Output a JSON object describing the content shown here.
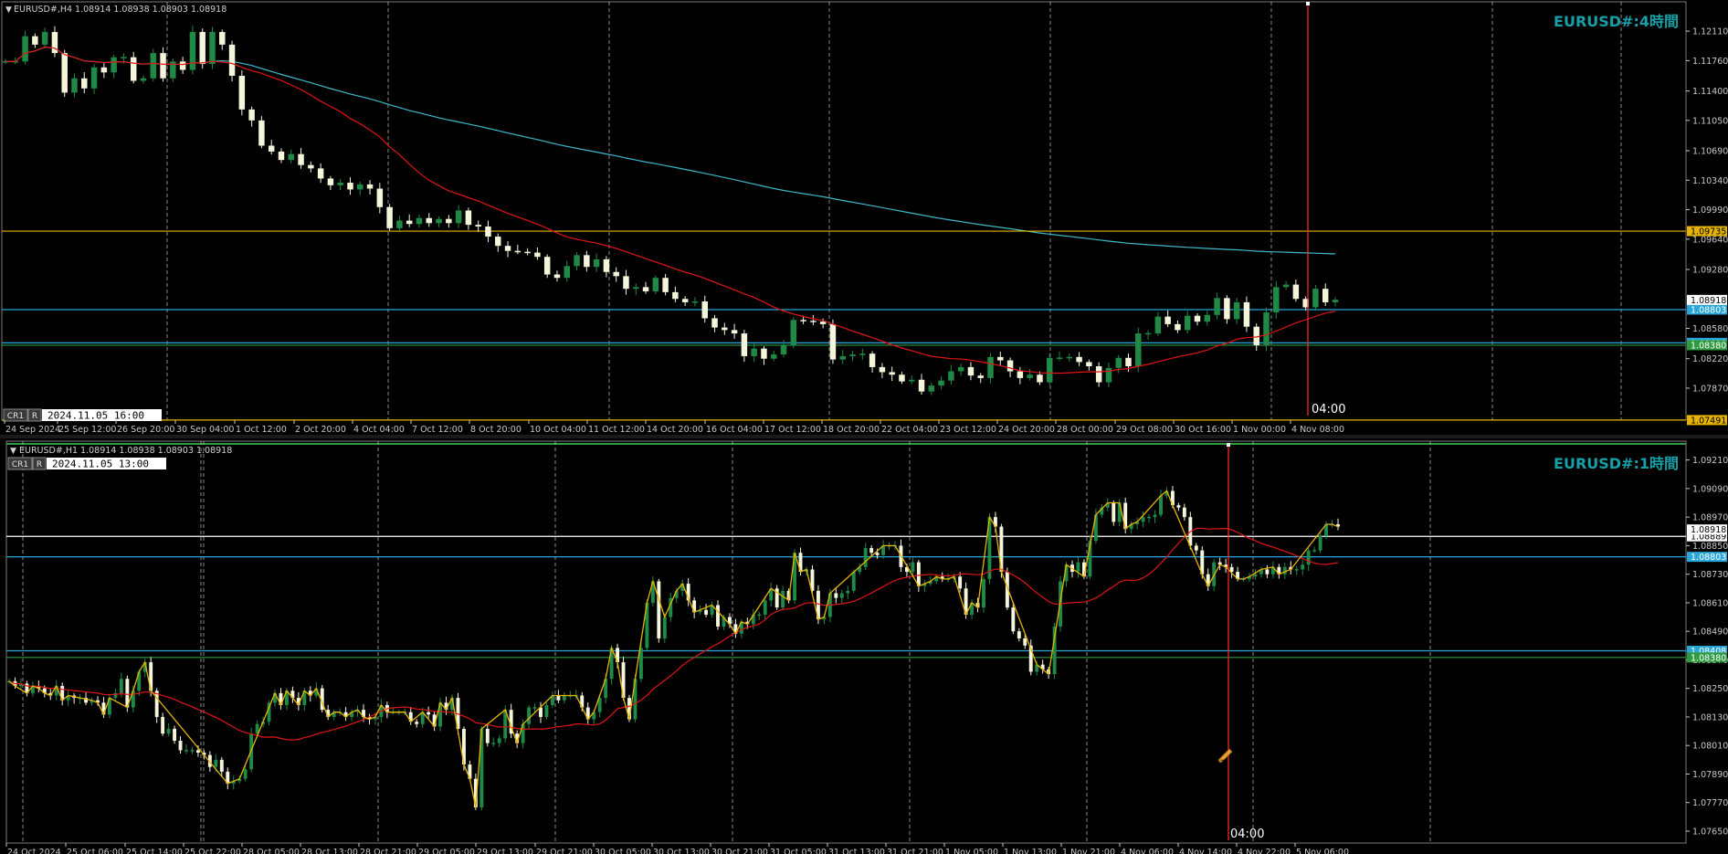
{
  "colors": {
    "background": "#000000",
    "grid": "#c8c8c8",
    "axis_text": "#c8c8c8",
    "candle_up": "#1f8a46",
    "candle_down": "#f5f5dc",
    "ma_red": "#e01515",
    "ma_cyan": "#3fb7c7",
    "zigzag": "#e6b400",
    "title": "#18a0a8",
    "crosshair": "#ff2a2a",
    "line_yellow": "#e6b400",
    "line_blue": "#2aa7d8",
    "line_green": "#2f9a40",
    "line_white": "#ffffff"
  },
  "top_panel": {
    "header": "EURUSD#,H4  1.08914 1.08938 1.08903 1.08918",
    "title": "EURUSD#:4時間",
    "controls": [
      "CR1",
      "R"
    ],
    "datetime_box": "2024.11.05 16:00",
    "crosshair_label": "04:00"
  },
  "bottom_panel": {
    "header": "EURUSD#,H1  1.08914 1.08938 1.08903 1.08918",
    "title": "EURUSD#:1時間",
    "controls": [
      "CR1",
      "R"
    ],
    "datetime_box": "2024.11.05 13:00",
    "crosshair_label": "04:00"
  },
  "chart_data": [
    {
      "type": "candlestick",
      "symbol": "EURUSD#",
      "timeframe": "H4",
      "title": "EURUSD#:4時間",
      "ylim": [
        1.0749,
        1.1235
      ],
      "y_ticks": [
        "1.12110",
        "1.11760",
        "1.11400",
        "1.11050",
        "1.10690",
        "1.10340",
        "1.09990",
        "1.09640",
        "1.09280",
        "1.08580",
        "1.08220",
        "1.07870"
      ],
      "x_ticks": [
        "24 Sep 2024",
        "25 Sep 12:00",
        "26 Sep 20:00",
        "30 Sep 04:00",
        "1 Oct 12:00",
        "2 Oct 20:00",
        "4 Oct 04:00",
        "7 Oct 12:00",
        "8 Oct 20:00",
        "10 Oct 04:00",
        "11 Oct 12:00",
        "14 Oct 20:00",
        "16 Oct 04:00",
        "17 Oct 12:00",
        "18 Oct 20:00",
        "22 Oct 04:00",
        "23 Oct 12:00",
        "24 Oct 20:00",
        "28 Oct 00:00",
        "29 Oct 08:00",
        "30 Oct 16:00",
        "1 Nov 00:00",
        "4 Nov 08:00"
      ],
      "horizontal_lines": [
        {
          "price": 1.09735,
          "label": "1.09735",
          "color": "#e6b400"
        },
        {
          "price": 1.08803,
          "label": "1.08803",
          "color": "#2aa7d8"
        },
        {
          "price": 1.08408,
          "label": "1.08408",
          "color": "#2aa7d8"
        },
        {
          "price": 1.0838,
          "label": "1.08380",
          "color": "#2f9a40"
        },
        {
          "price": 1.07491,
          "label": "1.07491",
          "color": "#e6b400"
        }
      ],
      "current_price": {
        "price": 1.08918,
        "label": "1.08918"
      },
      "closes": [
        1.1175,
        1.1175,
        1.1205,
        1.1195,
        1.121,
        1.1185,
        1.1138,
        1.1155,
        1.1143,
        1.1168,
        1.1162,
        1.118,
        1.118,
        1.1152,
        1.1155,
        1.1185,
        1.1155,
        1.1175,
        1.1165,
        1.121,
        1.1172,
        1.121,
        1.1195,
        1.1158,
        1.1118,
        1.1105,
        1.1075,
        1.1068,
        1.1058,
        1.1065,
        1.1052,
        1.1048,
        1.1036,
        1.1028,
        1.1031,
        1.1023,
        1.1029,
        1.1024,
        1.1002,
        1.0977,
        1.0986,
        1.0982,
        1.0989,
        1.0983,
        1.0988,
        1.0983,
        1.0998,
        1.0981,
        1.0979,
        1.0967,
        1.0956,
        1.095,
        1.0949,
        1.0948,
        1.0943,
        1.0922,
        1.0918,
        1.0932,
        1.0945,
        1.0931,
        1.094,
        1.0925,
        1.092,
        1.0905,
        1.0907,
        1.0902,
        1.0918,
        1.0901,
        1.0893,
        1.0889,
        1.089,
        1.087,
        1.0859,
        1.0856,
        1.0852,
        1.0825,
        1.0834,
        1.0822,
        1.0827,
        1.0838,
        1.0868,
        1.0867,
        1.0866,
        1.0863,
        1.0821,
        1.0825,
        1.0827,
        1.0828,
        1.0812,
        1.0806,
        1.0803,
        1.0795,
        1.0797,
        1.0783,
        1.079,
        1.0796,
        1.0807,
        1.0812,
        1.0802,
        1.0799,
        1.0824,
        1.082,
        1.0807,
        1.0799,
        1.0803,
        1.0794,
        1.0823,
        1.0823,
        1.0824,
        1.0818,
        1.0813,
        1.0794,
        1.0811,
        1.0823,
        1.0813,
        1.0852,
        1.0852,
        1.0872,
        1.0863,
        1.0856,
        1.0873,
        1.0866,
        1.0874,
        1.0894,
        1.0869,
        1.0889,
        1.086,
        1.0838,
        1.0877,
        1.0907,
        1.091,
        1.0893,
        1.0883,
        1.0905,
        1.0889,
        1.0892
      ]
    },
    {
      "type": "candlestick",
      "symbol": "EURUSD#",
      "timeframe": "H1",
      "title": "EURUSD#:1時間",
      "ylim": [
        1.076,
        1.0927
      ],
      "y_ticks": [
        "1.09210",
        "1.09090",
        "1.08970",
        "1.08850",
        "1.08730",
        "1.08610",
        "1.08490",
        "1.08370",
        "1.08250",
        "1.08130",
        "1.08010",
        "1.07890",
        "1.07770",
        "1.07650"
      ],
      "x_ticks": [
        "24 Oct 2024",
        "25 Oct 06:00",
        "25 Oct 14:00",
        "25 Oct 22:00",
        "28 Oct 05:00",
        "28 Oct 13:00",
        "28 Oct 21:00",
        "29 Oct 05:00",
        "29 Oct 13:00",
        "29 Oct 21:00",
        "30 Oct 05:00",
        "30 Oct 13:00",
        "30 Oct 21:00",
        "31 Oct 05:00",
        "31 Oct 13:00",
        "31 Oct 21:00",
        "1 Nov 05:00",
        "1 Nov 13:00",
        "1 Nov 21:00",
        "4 Nov 06:00",
        "4 Nov 14:00",
        "4 Nov 22:00",
        "5 Nov 06:00"
      ],
      "horizontal_lines": [
        {
          "price": 1.08889,
          "label": "1.08889",
          "color": "#ffffff"
        },
        {
          "price": 1.08803,
          "label": "1.08803",
          "color": "#2aa7d8"
        },
        {
          "price": 1.08408,
          "label": "1.08408",
          "color": "#2aa7d8"
        },
        {
          "price": 1.0838,
          "label": "1.08380",
          "color": "#2f9a40"
        }
      ],
      "current_price": {
        "price": 1.08918,
        "label": "1.08918"
      },
      "closes": [
        1.0828,
        1.0826,
        1.0827,
        1.0823,
        1.0826,
        1.0825,
        1.0823,
        1.0822,
        1.0826,
        1.082,
        1.0822,
        1.0821,
        1.0821,
        1.0819,
        1.082,
        1.0819,
        1.0814,
        1.0821,
        1.0823,
        1.0829,
        1.0817,
        1.0824,
        1.0832,
        1.0836,
        1.0824,
        1.0813,
        1.0806,
        1.0808,
        1.0803,
        1.0799,
        1.0799,
        1.0799,
        1.0798,
        1.0797,
        1.0792,
        1.0795,
        1.079,
        1.0785,
        1.0786,
        1.0787,
        1.0791,
        1.0806,
        1.081,
        1.0811,
        1.0819,
        1.0823,
        1.0818,
        1.0824,
        1.0821,
        1.0818,
        1.0824,
        1.0822,
        1.0825,
        1.0816,
        1.0813,
        1.0815,
        1.0815,
        1.0813,
        1.0815,
        1.0816,
        1.0813,
        1.0812,
        1.0813,
        1.0818,
        1.0815,
        1.0815,
        1.0815,
        1.0815,
        1.0811,
        1.081,
        1.0815,
        1.0814,
        1.0809,
        1.0819,
        1.0816,
        1.0821,
        1.0808,
        1.0793,
        1.0787,
        1.0775,
        1.0808,
        1.0802,
        1.0802,
        1.0804,
        1.0816,
        1.0806,
        1.0802,
        1.081,
        1.0817,
        1.0817,
        1.0813,
        1.0818,
        1.0822,
        1.082,
        1.0822,
        1.0822,
        1.0822,
        1.0817,
        1.0812,
        1.0815,
        1.0821,
        1.0829,
        1.0842,
        1.0836,
        1.0821,
        1.0812,
        1.0829,
        1.0842,
        1.0861,
        1.087,
        1.0846,
        1.0855,
        1.0863,
        1.0866,
        1.0869,
        1.0862,
        1.0857,
        1.0858,
        1.0856,
        1.086,
        1.0851,
        1.0855,
        1.0852,
        1.0848,
        1.0853,
        1.0852,
        1.0856,
        1.0856,
        1.0862,
        1.0867,
        1.0859,
        1.0866,
        1.0862,
        1.0882,
        1.0874,
        1.0875,
        1.0866,
        1.0854,
        1.0855,
        1.0865,
        1.0863,
        1.0865,
        1.0866,
        1.0874,
        1.0876,
        1.0884,
        1.0882,
        1.0881,
        1.0885,
        1.0885,
        1.0885,
        1.0876,
        1.0874,
        1.0878,
        1.0868,
        1.0869,
        1.087,
        1.0872,
        1.0871,
        1.0871,
        1.0872,
        1.0867,
        1.0856,
        1.0861,
        1.0859,
        1.0871,
        1.0897,
        1.0893,
        1.0874,
        1.0859,
        1.0849,
        1.0846,
        1.0843,
        1.0832,
        1.0835,
        1.0833,
        1.0831,
        1.0851,
        1.087,
        1.0877,
        1.0874,
        1.0878,
        1.0872,
        1.0887,
        1.0898,
        1.0901,
        1.0903,
        1.0895,
        1.0903,
        1.0892,
        1.0894,
        1.0895,
        1.0897,
        1.0897,
        1.0898,
        1.0906,
        1.0908,
        1.0902,
        1.0901,
        1.0897,
        1.0885,
        1.0883,
        1.0873,
        1.0868,
        1.0878,
        1.0877,
        1.0876,
        1.0874,
        1.0871,
        1.0871,
        1.0872,
        1.0873,
        1.0875,
        1.0873,
        1.0876,
        1.0873,
        1.0876,
        1.0875,
        1.0875,
        1.0877,
        1.0883,
        1.0883,
        1.0889,
        1.0894,
        1.0894,
        1.0893
      ]
    }
  ]
}
